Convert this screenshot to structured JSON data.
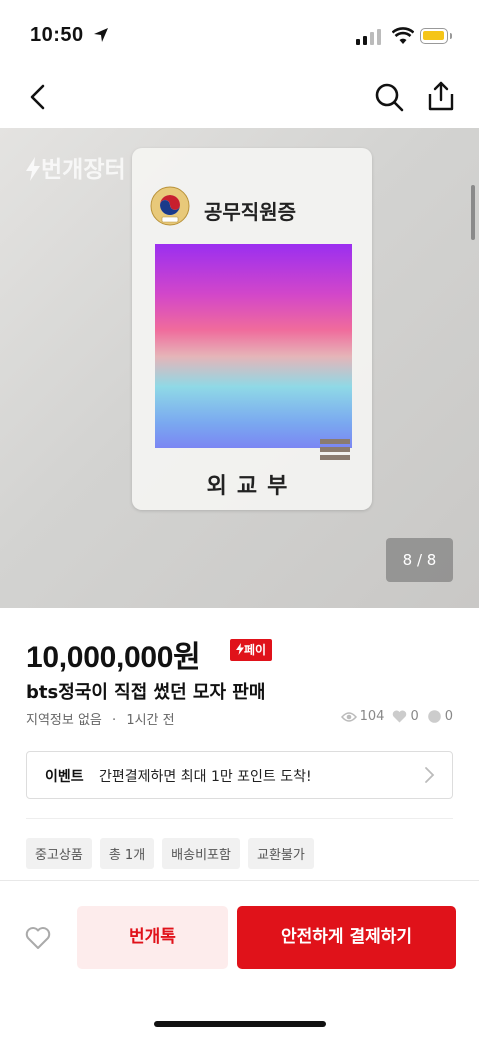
{
  "status_bar": {
    "time": "10:50"
  },
  "watermark": "번개장터",
  "card": {
    "title": "공무직원증",
    "department": "외교부"
  },
  "gallery": {
    "page_indicator": "8 / 8"
  },
  "product": {
    "price": "10,000,000원",
    "pay_badge": "페이",
    "title": "bts정국이 직접 썼던 모자 판매",
    "location": "지역정보 없음",
    "separator": "·",
    "posted": "1시간 전",
    "views": "104",
    "likes": "0",
    "chats": "0"
  },
  "event": {
    "label": "이벤트",
    "text": "간편결제하면 최대 1만 포인트 도착!"
  },
  "tags": [
    "중고상품",
    "총 1개",
    "배송비포함",
    "교환불가"
  ],
  "actions": {
    "chat_label": "번개톡",
    "pay_label": "안전하게 결제하기"
  },
  "colors": {
    "accent": "#e0121a",
    "chat_bg": "#fdecec"
  },
  "icons": [
    "back-icon",
    "search-icon",
    "share-icon",
    "heart-icon",
    "eye-icon",
    "chevron-right-icon",
    "bolt-icon"
  ]
}
